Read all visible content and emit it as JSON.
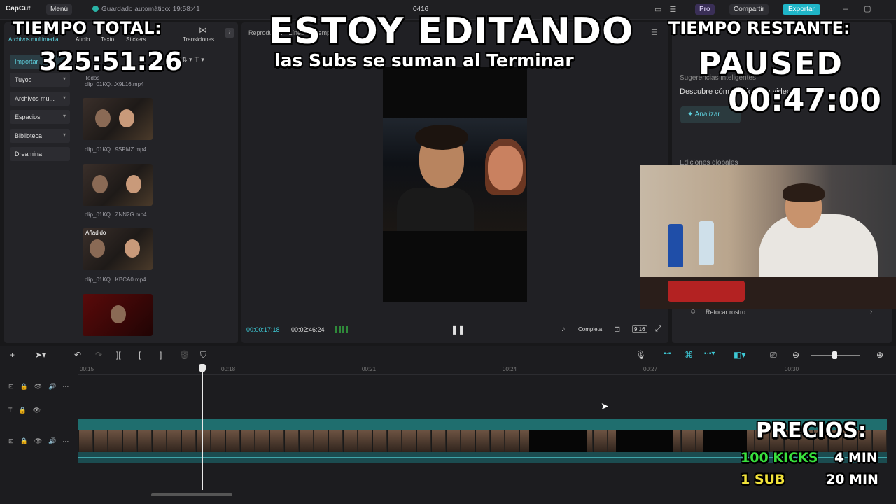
{
  "titlebar": {
    "app_name": "CapCut",
    "menu_label": "Menú",
    "autosave": "Guardado automático: 19:58:41",
    "project_name": "0416",
    "pro_label": "Pro",
    "share_label": "Compartir",
    "export_label": "Exportar"
  },
  "left_panel": {
    "tabs": [
      "Archivos multimedia",
      "Audio",
      "Texto",
      "Stickers",
      "Efectos",
      "Transiciones"
    ],
    "side_items": [
      {
        "label": "Importar",
        "active": true
      },
      {
        "label": "Tuyos"
      },
      {
        "label": "Archivos mu..."
      },
      {
        "label": "Espacios"
      },
      {
        "label": "Biblioteca"
      },
      {
        "label": "Dreamina"
      }
    ],
    "section_label": "Todos",
    "added_label": "Añadido",
    "clips": [
      {
        "name": "clip_01KQ...X9L16.mp4"
      },
      {
        "name": "clip_01KQ...9SPMZ.mp4"
      },
      {
        "name": "clip_01KQ...ZNN2G.mp4"
      },
      {
        "name": "clip_01KQ...KBCA0.mp4"
      }
    ]
  },
  "player": {
    "title": "Reproductor - Línea de tiempo",
    "current_time": "00:00:17:18",
    "total_time": "00:02:46:24",
    "full_label": "Completa",
    "ratio_label": "9:16"
  },
  "right_panel": {
    "suggestions_title": "Sugerencias inteligentes",
    "suggestions_desc": "Descubre cómo mejorar tu video",
    "analyze_label": "Analizar",
    "global_edits": "Ediciones globales",
    "retouch_label": "Retocar rostro"
  },
  "timeline": {
    "ticks": [
      "00:15",
      "00:18",
      "00:21",
      "00:24",
      "00:27",
      "00:30"
    ]
  },
  "overlay": {
    "total_label": "TIEMPO TOTAL:",
    "total_value": "325:51:26",
    "title": "ESTOY EDITANDO",
    "subtitle": "las Subs se suman al Terminar",
    "remaining_label": "TIEMPO RESTANTE:",
    "paused": "PAUSED",
    "remaining_value": "00:47:00",
    "prices_label": "PRECIOS:",
    "kicks_label": "100 KICKS",
    "kicks_time": "4 MIN",
    "sub_label": "1 SUB",
    "sub_time": "20 MIN"
  },
  "colors": {
    "accent": "#1fb5c8",
    "kicks": "#38e03c",
    "sub": "#f1e23a",
    "track": "#1f6e6e"
  }
}
